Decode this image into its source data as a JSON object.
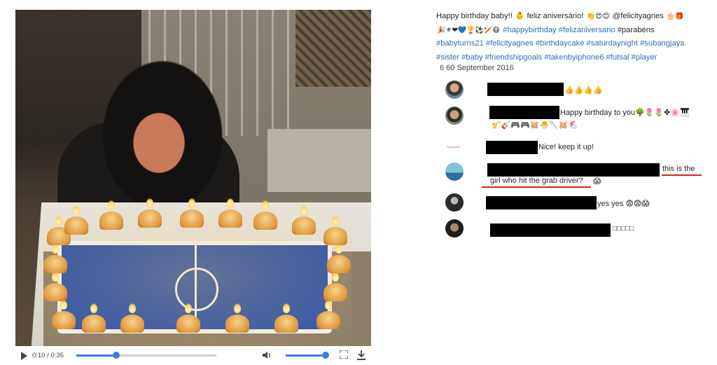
{
  "video": {
    "time_display": "0:10 / 0:35",
    "progress_fraction": 0.2857,
    "volume_fraction": 0.9
  },
  "post": {
    "caption_text": "Happy birthday baby!! ",
    "caption_text2": " feliz aniversário! ",
    "caption_user": "@felicityagnes",
    "hashtags_line2": "#happybirthday #felizaniversario",
    "plain_line2": "#parabéns",
    "hashtags_line3": "#babyturns21 #felicityagnes #birthdaycake #saturdaynight #subangjaya",
    "hashtags_line4": "#sister #baby #friendshipgoals #takenbyiphone6 #futsal #player",
    "date": "6 60 September 2016"
  },
  "comments": [
    {
      "text": "👍👍👍👍"
    },
    {
      "text": "Happy birthday to you🌳🌷🌷✤🌸🎹",
      "text2": "🎷🎸🎮🎮🐹🐣🥄🐹🐔"
    },
    {
      "text": "Nice! keep it up!"
    },
    {
      "text_underlined": "this is the",
      "text2_underlined": "girl who hit the grab driver?",
      "emoji": "😱"
    },
    {
      "text": "yes yes 😨😨😱"
    },
    {
      "text": "□□□□□"
    }
  ],
  "colors": {
    "link": "#2d6fb8",
    "accent": "#3b7ddd",
    "underline": "#d8231f"
  }
}
